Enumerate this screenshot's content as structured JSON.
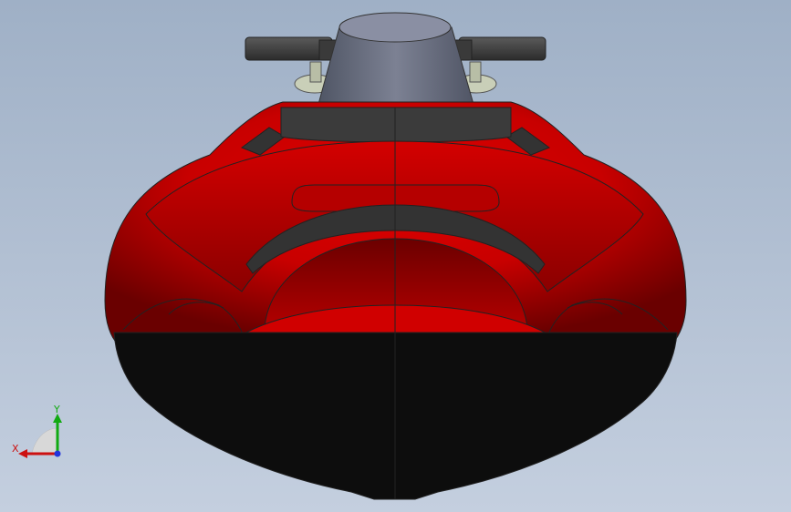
{
  "viewport": {
    "background_top": "#9fb0c6",
    "background_bottom": "#c4cfdf"
  },
  "model": {
    "hull_color": "#cc0000",
    "hull_dark": "#7a0000",
    "bottom_color": "#0d0d0d",
    "trim_color": "#3a3a3a",
    "handlebar_color": "#454545",
    "steering_column_color": "#6e7384"
  },
  "triad": {
    "x_label": "X",
    "y_label": "Y",
    "x_color": "#cc1111",
    "y_color": "#11aa11",
    "z_color": "#2233dd"
  }
}
